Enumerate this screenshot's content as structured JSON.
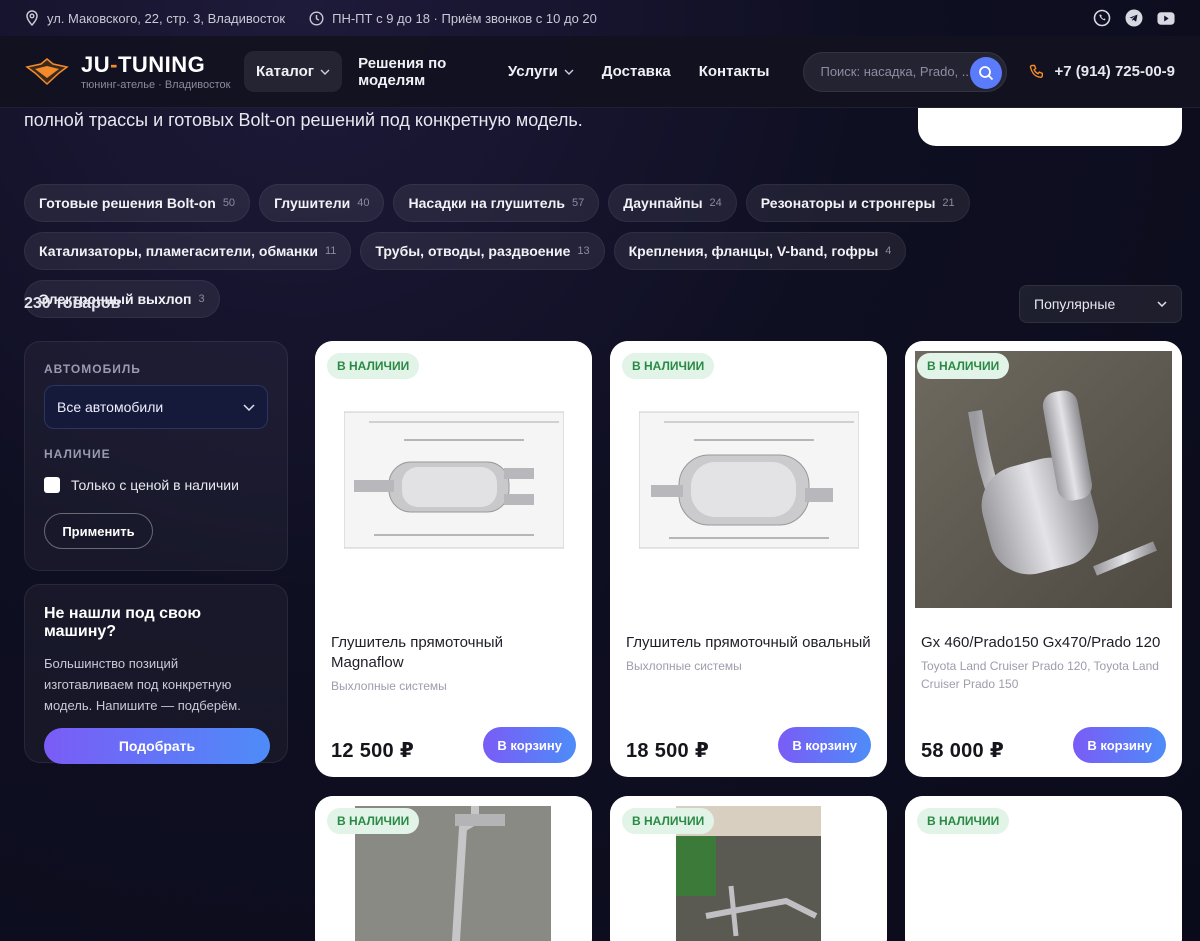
{
  "topbar": {
    "address": "ул. Маковского, 22, стр. 3, Владивосток",
    "hours": "ПН-ПТ с 9 до 18 · Приём звонков с 10 до 20",
    "socials": [
      "whatsapp-icon",
      "telegram-icon",
      "youtube-icon"
    ]
  },
  "header": {
    "logo_name_part1": "JU",
    "logo_name_dash": "-",
    "logo_name_part2": "TUNING",
    "logo_sub": "тюнинг-ателье · Владивосток",
    "nav": [
      {
        "label": "Каталог",
        "dropdown": true,
        "active": true
      },
      {
        "label": "Решения по моделям",
        "dropdown": false
      },
      {
        "label": "Услуги",
        "dropdown": true
      },
      {
        "label": "Доставка",
        "dropdown": false
      },
      {
        "label": "Контакты",
        "dropdown": false
      }
    ],
    "search_placeholder": "Поиск: насадка, Prado, ...",
    "phone": "+7 (914) 725-00-9"
  },
  "intro_text": "полной трассы и готовых Bolt-on решений под конкретную модель.",
  "categories": [
    {
      "label": "Готовые решения Bolt-on",
      "count": "50"
    },
    {
      "label": "Глушители",
      "count": "40"
    },
    {
      "label": "Насадки на глушитель",
      "count": "57"
    },
    {
      "label": "Даунпайпы",
      "count": "24"
    },
    {
      "label": "Резонаторы и стронгеры",
      "count": "21"
    },
    {
      "label": "Катализаторы, пламегасители, обманки",
      "count": "11"
    },
    {
      "label": "Трубы, отводы, раздвоение",
      "count": "13"
    },
    {
      "label": "Крепления, фланцы, V-band, гофры",
      "count": "4"
    },
    {
      "label": "Электронный выхлоп",
      "count": "3"
    }
  ],
  "count_text": "230 товаров",
  "sort_value": "Популярные",
  "filters": {
    "car_label": "АВТОМОБИЛЬ",
    "car_value": "Все автомобили",
    "stock_label": "НАЛИЧИЕ",
    "stock_checkbox": "Только с ценой в наличии",
    "apply": "Применить"
  },
  "help": {
    "title": "Не нашли под свою машину?",
    "text": "Большинство позиций изготавливаем под конкретную модель. Напишите — подберём.",
    "button": "Подобрать"
  },
  "products": [
    {
      "badge": "В НАЛИЧИИ",
      "title": "Глушитель прямоточный Magnaflow",
      "category": "Выхлопные системы",
      "price": "12 500 ₽",
      "cart": "В корзину",
      "image": "muffler-drawing"
    },
    {
      "badge": "В НАЛИЧИИ",
      "title": "Глушитель прямоточный овальный",
      "category": "Выхлопные системы",
      "price": "18 500 ₽",
      "cart": "В корзину",
      "image": "muffler-drawing"
    },
    {
      "badge": "В НАЛИЧИИ",
      "title": "Gx 460/Prado150 Gx470/Prado 120",
      "category": "Toyota Land Cruiser Prado 120, Toyota Land Cruiser Prado 150",
      "price": "58 000 ₽",
      "cart": "В корзину",
      "image": "exhaust-photo"
    },
    {
      "badge": "В НАЛИЧИИ",
      "image": "pipe-photo"
    },
    {
      "badge": "В НАЛИЧИИ",
      "image": "exhaust-ground-photo"
    },
    {
      "badge": "В НАЛИЧИИ",
      "image": "none"
    }
  ]
}
